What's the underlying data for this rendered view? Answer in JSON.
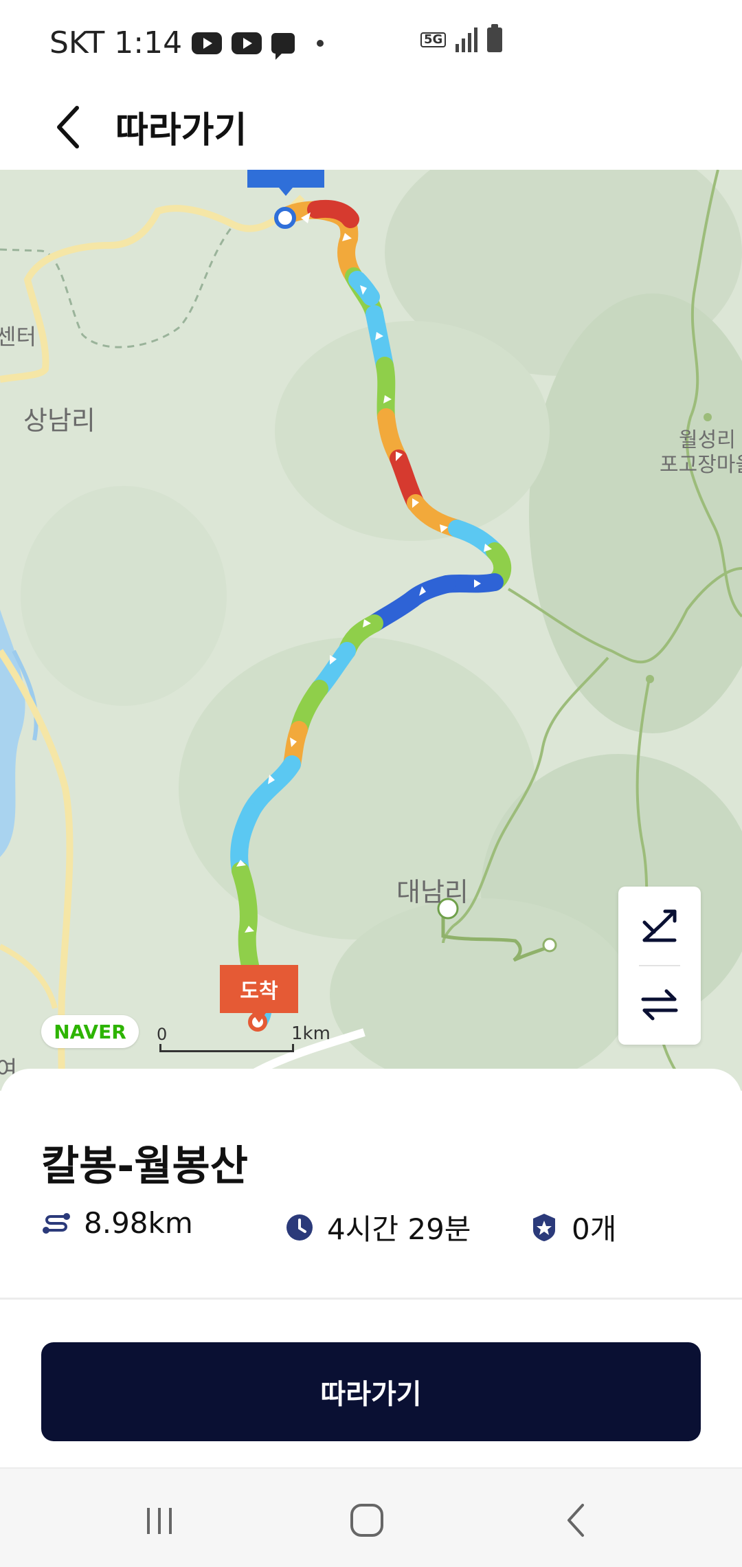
{
  "status_bar": {
    "carrier": "SKT",
    "time": "1:14",
    "network": "5G"
  },
  "header": {
    "title": "따라가기",
    "back_icon": "chevron-left-icon"
  },
  "map": {
    "labels": {
      "sangnam": "상남리",
      "center_partial": "센터",
      "wolseong": "월성리",
      "pogojang": "포고장마을",
      "daenam": "대남리",
      "bottom_partial": "여"
    },
    "start_marker": "출발",
    "arrive_marker": "도착",
    "provider": "NAVER",
    "scale": {
      "zero": "0",
      "unit": "1km"
    },
    "controls": [
      "elevation-icon",
      "swap-direction-icon"
    ],
    "route_colors": [
      "#f2a93b",
      "#d63a2f",
      "#8fcf4a",
      "#5bc8f2",
      "#2e63d6"
    ]
  },
  "course": {
    "title": "칼봉-월봉산",
    "distance": "8.98km",
    "duration": "4시간 29분",
    "badge_count": "0개",
    "icons": [
      "route-icon",
      "clock-icon",
      "badge-icon"
    ]
  },
  "action": {
    "follow_label": "따라가기"
  },
  "nav_bar": [
    "recents-icon",
    "home-icon",
    "back-icon"
  ],
  "colors": {
    "primary_button": "#0a1033",
    "arrive_marker": "#e55a35",
    "start_marker": "#2f6fd9",
    "naver_green": "#2db400",
    "icon_navy": "#2b3a7a"
  }
}
